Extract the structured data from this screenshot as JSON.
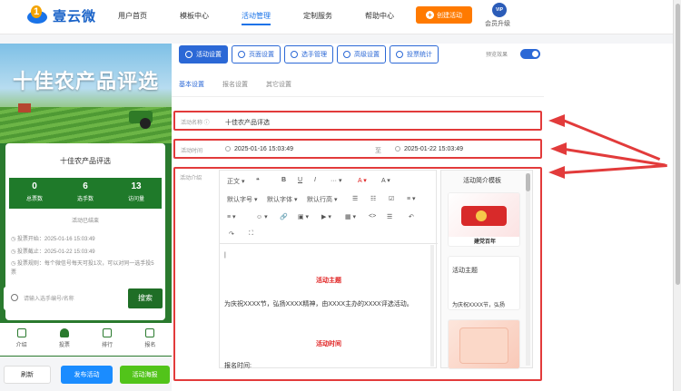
{
  "brand": {
    "name": "壹云微",
    "logo_glyph": "1"
  },
  "nav": [
    "用户首页",
    "模板中心",
    "活动管理",
    "定制服务",
    "帮助中心"
  ],
  "nav_active": "活动管理",
  "create_button": "创建活动",
  "vip": {
    "badge": "VIP",
    "label": "会员升级"
  },
  "preview": {
    "banner_title": "十佳农产品评选",
    "card_title": "十佳农产品评选",
    "stats": [
      {
        "value": "0",
        "label": "总票数"
      },
      {
        "value": "6",
        "label": "选手数"
      },
      {
        "value": "13",
        "label": "访问量"
      }
    ],
    "ended": "活动已结束",
    "vote_start": "投票开始：2025-01-16 15:03:49",
    "vote_end": "投票截止：2025-01-22 15:03:49",
    "vote_rule": "投票规则：每个微信号每天可投1次，可以对同一选手投5票",
    "search_placeholder": "请输入选手编号/名称",
    "search_button": "搜索",
    "tabbar": [
      "介绍",
      "投票",
      "排行",
      "报名"
    ],
    "btn_refresh": "刷新",
    "btn_publish": "发布活动",
    "btn_poster": "活动海报"
  },
  "settings_tabs": [
    "活动设置",
    "页面设置",
    "选手管理",
    "高级设置",
    "投票统计"
  ],
  "preview_effect_label": "预览效果",
  "sub_tabs": [
    "基本设置",
    "报名设置",
    "其它设置"
  ],
  "form": {
    "name_label": "活动名称 ⓘ",
    "name_value": "十佳农产品评选",
    "time_label": "活动时间",
    "start_time": "2025-01-16 15:03:49",
    "time_sep": "至",
    "end_time": "2025-01-22 15:03:49",
    "intro_label": "活动介绍"
  },
  "editor": {
    "toolbar_row1": [
      "正文 ▾",
      "❝",
      "B",
      "U",
      "I",
      "··· ▾",
      "A ▾",
      "A ▾"
    ],
    "toolbar_row2": [
      "默认字号 ▾",
      "默认字体 ▾",
      "默认行高 ▾",
      "☰",
      "☷",
      "☑",
      "≡ ▾"
    ],
    "toolbar_row3": [
      "≡ ▾",
      "☺ ▾",
      "🔗",
      "▣ ▾",
      "▶ ▾",
      "▦ ▾",
      "<>",
      "☰",
      "↶"
    ],
    "toolbar_row4": [
      "↷",
      "⛶"
    ],
    "cursor": "|",
    "heading1": "活动主题",
    "body1": "为庆祝XXXX节，弘扬XXXX精神，由XXXX主办的XXXX评选活动。",
    "heading2": "活动时间",
    "body2": "报名时间:"
  },
  "templates": {
    "header": "活动简介模板",
    "card1_text": "建党百年",
    "card2_title": "活动主题",
    "card2_text": "为庆祝XXXX节，弘扬"
  },
  "colors": {
    "accent": "#2b68d6",
    "orange": "#ff7a00",
    "green": "#1f7a2a",
    "highlight": "#e23b3b"
  }
}
